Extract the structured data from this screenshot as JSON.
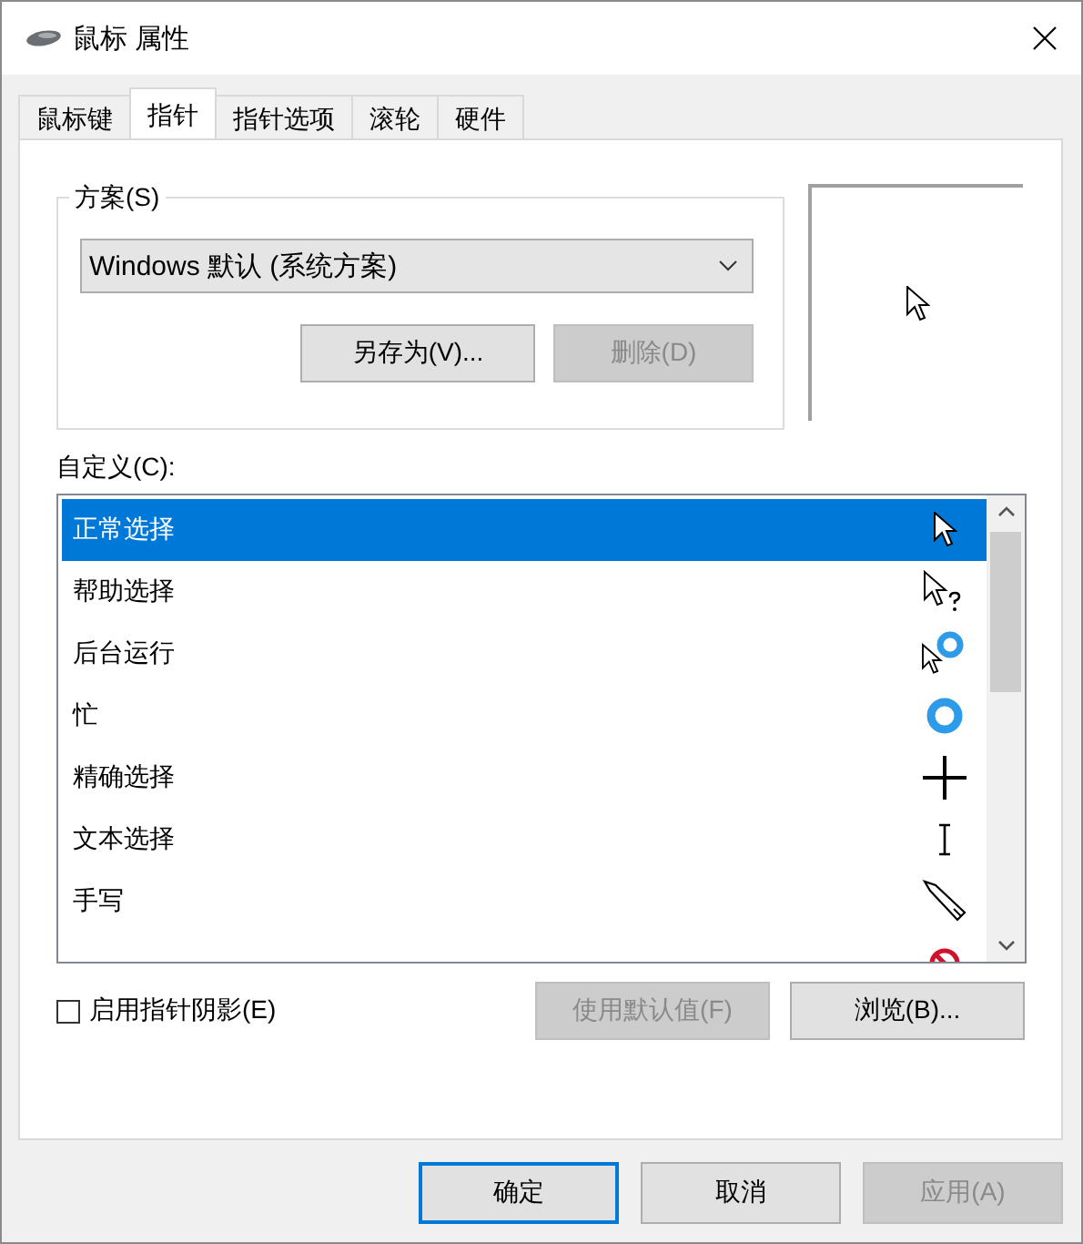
{
  "window": {
    "title": "鼠标 属性"
  },
  "tabs": [
    {
      "label": "鼠标键",
      "selected": false
    },
    {
      "label": "指针",
      "selected": true
    },
    {
      "label": "指针选项",
      "selected": false
    },
    {
      "label": "滚轮",
      "selected": false
    },
    {
      "label": "硬件",
      "selected": false
    }
  ],
  "scheme": {
    "label": "方案(S)",
    "value": "Windows 默认 (系统方案)",
    "buttons": [
      {
        "label": "另存为(V)...",
        "disabled": false
      },
      {
        "label": "删除(D)",
        "disabled": true
      }
    ]
  },
  "customize": {
    "label": "自定义(C):",
    "rows": [
      {
        "label": "正常选择",
        "kind": "arrow",
        "selected": true
      },
      {
        "label": "帮助选择",
        "kind": "help",
        "selected": false
      },
      {
        "label": "后台运行",
        "kind": "working",
        "selected": false
      },
      {
        "label": "忙",
        "kind": "busy",
        "selected": false
      },
      {
        "label": "精确选择",
        "kind": "cross",
        "selected": false
      },
      {
        "label": "文本选择",
        "kind": "text",
        "selected": false
      },
      {
        "label": "手写",
        "kind": "pen",
        "selected": false
      },
      {
        "kind": "unavailable",
        "selected": false
      }
    ]
  },
  "shadow": {
    "label": "启用指针阴影(E)",
    "checked": false
  },
  "list_buttons": [
    {
      "label": "使用默认值(F)",
      "disabled": true
    },
    {
      "label": "浏览(B)...",
      "disabled": false
    }
  ],
  "dialog_buttons": [
    {
      "label": "确定",
      "disabled": false,
      "default": true
    },
    {
      "label": "取消",
      "disabled": false,
      "default": false
    },
    {
      "label": "应用(A)",
      "disabled": true,
      "default": false
    }
  ]
}
